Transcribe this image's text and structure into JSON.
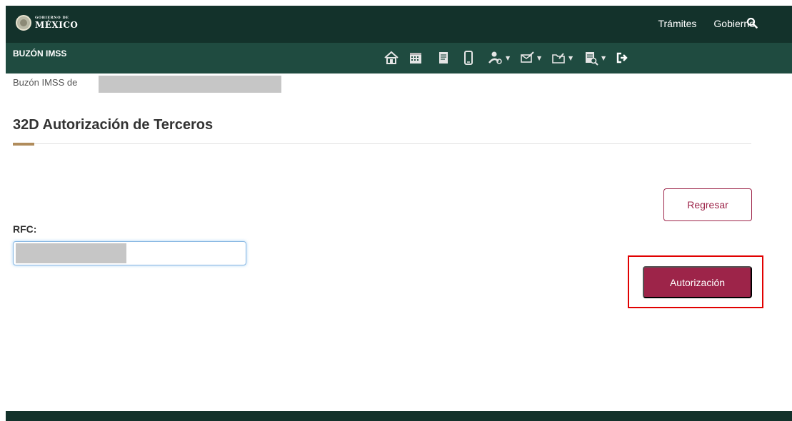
{
  "header": {
    "logo_small": "GOBIERNO DE",
    "logo_big": "MÉXICO",
    "nav": [
      "Trámites",
      "Gobierno"
    ],
    "search_icon": "search-icon"
  },
  "subbar": {
    "title": "BUZÓN IMSS",
    "icons": [
      "home-icon",
      "calendar-icon",
      "document-icon",
      "mobile-icon",
      "user-settings-icon",
      "message-icon",
      "folder-icon",
      "report-icon",
      "logout-icon"
    ]
  },
  "breadcrumb": {
    "prefix": "Buzón IMSS de"
  },
  "page": {
    "title": "32D Autorización de Terceros"
  },
  "form": {
    "rfc_label": "RFC:",
    "rfc_value": "",
    "back_label": "Regresar",
    "auth_label": "Autorización"
  },
  "colors": {
    "primary_dark": "#13322b",
    "secondary_dark": "#1f4b40",
    "accent_gold": "#b08c5c",
    "button_wine": "#9d2449",
    "highlight_red": "#e10000"
  }
}
